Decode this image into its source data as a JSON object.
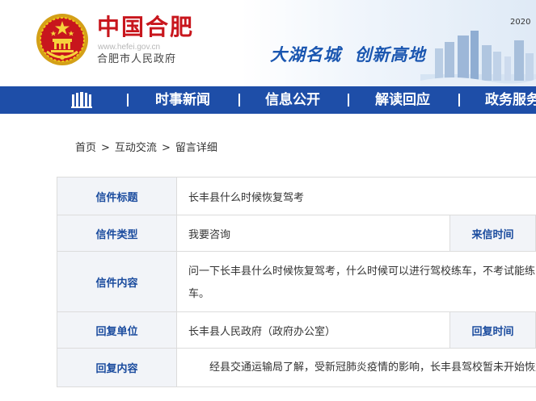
{
  "header": {
    "title": "中国合肥",
    "url": "www.hefei.gov.cn",
    "subtitle": "合肥市人民政府",
    "slogan": "大湖名城  创新高地",
    "date": "2020"
  },
  "nav": {
    "items": [
      {
        "label": "时事新闻"
      },
      {
        "label": "信息公开"
      },
      {
        "label": "解读回应"
      },
      {
        "label": "政务服务"
      }
    ]
  },
  "breadcrumb": {
    "home": "首页",
    "section": "互动交流",
    "current": "留言详细",
    "separator": ">"
  },
  "letter": {
    "title_label": "信件标题",
    "title_value": "长丰县什么时候恢复驾考",
    "type_label": "信件类型",
    "type_value": "我要咨询",
    "date_label": "来信时间",
    "content_label": "信件内容",
    "content_value": "问一下长丰县什么时候恢复驾考，什么时候可以进行驾校练车，不考试能练车。",
    "reply_unit_label": "回复单位",
    "reply_unit_value": "长丰县人民政府（政府办公室）",
    "reply_time_label": "回复时间",
    "reply_content_label": "回复内容",
    "reply_content_value": "经县交通运输局了解，受新冠肺炎疫情的影响，长丰县驾校暂未开始恢复"
  },
  "colors": {
    "brand_red": "#c8161d",
    "nav_blue": "#1e4ea8",
    "label_blue": "#1a4b9e",
    "label_bg": "#f2f4f8"
  }
}
